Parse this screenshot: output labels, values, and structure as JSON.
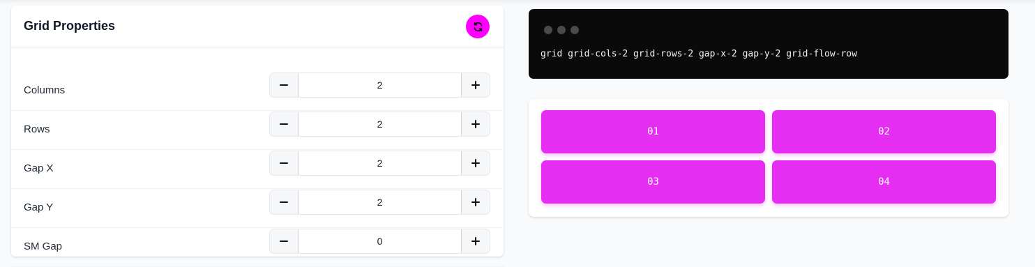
{
  "panel": {
    "title": "Grid Properties",
    "refresh_icon": "refresh-icon"
  },
  "properties": [
    {
      "label": "Columns",
      "value": "2"
    },
    {
      "label": "Rows",
      "value": "2"
    },
    {
      "label": "Gap X",
      "value": "2"
    },
    {
      "label": "Gap Y",
      "value": "2"
    },
    {
      "label": "SM Gap",
      "value": "0"
    }
  ],
  "code": {
    "text": "grid grid-cols-2 grid-rows-2 gap-x-2 gap-y-2 grid-flow-row"
  },
  "preview": {
    "items": [
      "01",
      "02",
      "03",
      "04"
    ]
  },
  "colors": {
    "accent": "#ff00ff",
    "cell": "#e52ef2",
    "code_bg": "#0a0a0b"
  }
}
